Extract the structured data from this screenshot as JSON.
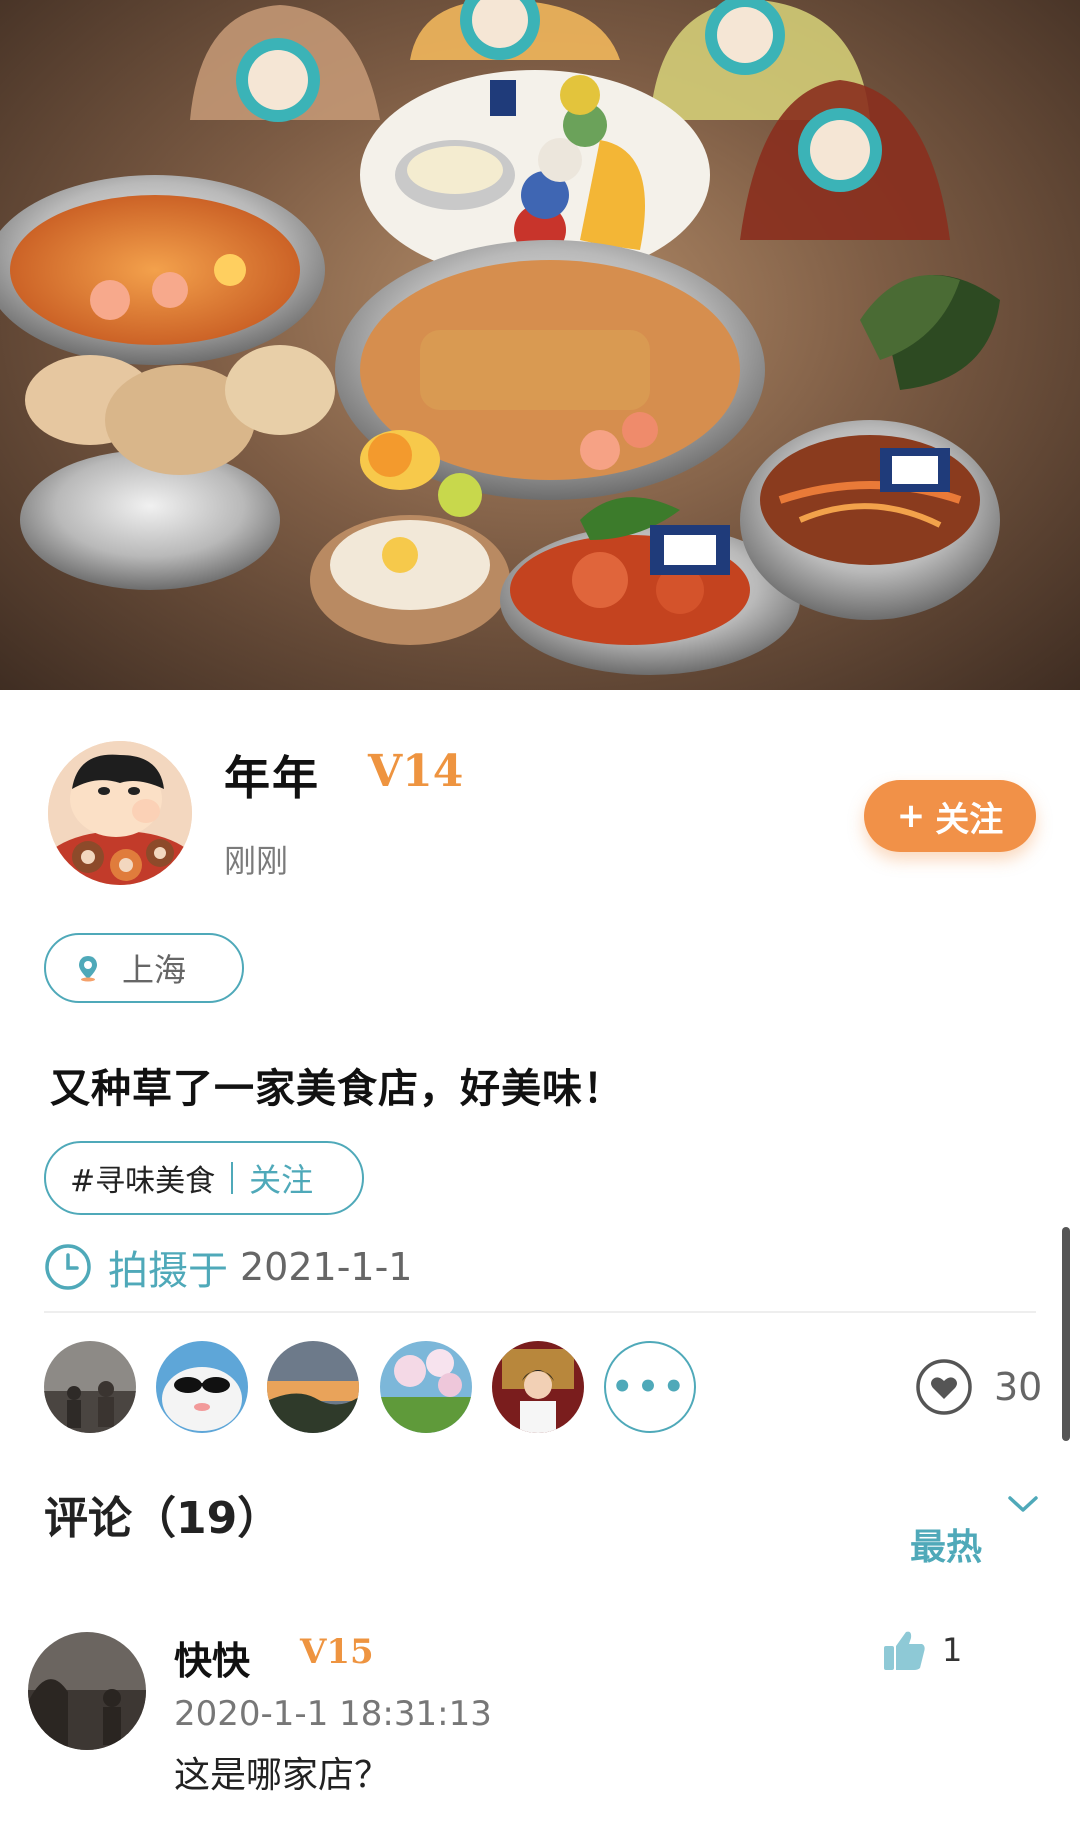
{
  "author": {
    "name": "年年",
    "level": "V14",
    "time": "刚刚",
    "follow_label": "关注",
    "follow_plus": "+"
  },
  "location": {
    "label": "上海",
    "icon": "location-pin-icon"
  },
  "post": {
    "text": "又种草了一家美食店，好美味！",
    "topic": "#寻味美食",
    "topic_follow": "关注",
    "shot_label": "拍摄于",
    "shot_date": "2021-1-1"
  },
  "likes": {
    "count": "30",
    "more": "•••",
    "likers": [
      "liker-1",
      "liker-2",
      "liker-3",
      "liker-4",
      "liker-5"
    ]
  },
  "comments": {
    "title": "评论（19）",
    "sort_label": "最热",
    "items": [
      {
        "author": "快快",
        "level": "V15",
        "time": "2020-1-1  18:31:13",
        "text": "这是哪家店？",
        "likes": "1"
      }
    ]
  },
  "colors": {
    "accent_teal": "#4fa9b9",
    "follow_orange": "#f19148",
    "level_orange": "#ee9440"
  }
}
